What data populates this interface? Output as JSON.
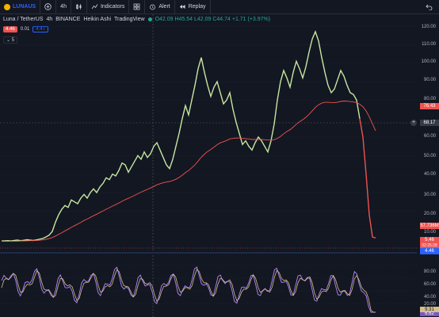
{
  "toolbar": {
    "symbol": "LUNAUS",
    "timeframe": "4h",
    "indicators_label": "Indicators",
    "alert_label": "Alert",
    "replay_label": "Replay"
  },
  "legend": {
    "title": "Luna / TetherUS",
    "interval": "4h",
    "exchange": "BINANCE",
    "chart_style": "Heikin Ashi",
    "source": "TradingView",
    "ohlc": "O42.09 H45.54 L42.09 C44.74 +1.71 (+3.97%)"
  },
  "order_boxes": {
    "sell": "4.46",
    "spread": "0.01",
    "buy": "4.47"
  },
  "collapse_label": "5",
  "price_axis": [
    "120.00",
    "110.00",
    "100.00",
    "90.00",
    "80.00",
    "60.00",
    "50.00",
    "40.00",
    "30.00",
    "20.00",
    "10.00"
  ],
  "price_tags": {
    "ma": "76.43",
    "cross": "68.17",
    "volume": "57.736M",
    "last": "5.46",
    "countdown": "02:25:28",
    "blue": "4.46"
  },
  "osc_axis": [
    "80.00",
    "60.00",
    "40.00",
    "20.00"
  ],
  "osc_tags": {
    "k": "9.31",
    "d": "6.62"
  },
  "colors": {
    "background": "#131722",
    "price": "#c8e6a0",
    "ma": "#ef5350",
    "crash": "#ef5350",
    "osc_k": "#b388ff",
    "osc_d": "#d4c08a"
  },
  "chart_data": {
    "type": "line",
    "series": [
      {
        "values": [
          3.8,
          3.9,
          4.0,
          3.8,
          4.1,
          4.3,
          4.0,
          4.2,
          4.5,
          4.3,
          4.1,
          4.4,
          4.8,
          5.2,
          6.0,
          7.0,
          9.0,
          14,
          18,
          21,
          23,
          22,
          26,
          25,
          24,
          27,
          29,
          27,
          30,
          32,
          30,
          33,
          35,
          38,
          37,
          40,
          39,
          42,
          46,
          45,
          41,
          44,
          47,
          50,
          48,
          52,
          49,
          51,
          55,
          57,
          53,
          49,
          45,
          43,
          48,
          55,
          62,
          70,
          77,
          72,
          80,
          88,
          97,
          103,
          95,
          88,
          82,
          87,
          90,
          84,
          78,
          80,
          84,
          75,
          68,
          62,
          56,
          58,
          55,
          53,
          57,
          60,
          58,
          55,
          52,
          58,
          67,
          80,
          90,
          96,
          92,
          87,
          95,
          101,
          97,
          92,
          98,
          106,
          113,
          117,
          112,
          103,
          95,
          88,
          84,
          86,
          91,
          96,
          93,
          88,
          84,
          83,
          80,
          70,
          60,
          40,
          18,
          6,
          5.46
        ]
      },
      {
        "values": [
          3.6,
          3.6,
          3.6,
          3.7,
          3.7,
          3.7,
          3.8,
          3.8,
          3.9,
          4.0,
          4.0,
          4.1,
          4.2,
          4.4,
          4.7,
          5.1,
          5.7,
          6.5,
          7.4,
          8.3,
          9.3,
          10.2,
          11.2,
          12.1,
          13.0,
          13.9,
          14.9,
          15.7,
          16.6,
          17.5,
          18.3,
          19.2,
          20.1,
          21.0,
          21.8,
          22.7,
          23.5,
          24.4,
          25.3,
          26.2,
          26.9,
          27.7,
          28.5,
          29.4,
          30.2,
          31.0,
          31.7,
          32.5,
          33.3,
          34.2,
          34.8,
          35.3,
          35.7,
          36.0,
          36.5,
          37.2,
          38.2,
          39.4,
          40.8,
          41.9,
          43.4,
          45.0,
          47.0,
          49.1,
          50.8,
          52.2,
          53.3,
          54.6,
          55.9,
          56.9,
          57.5,
          58.2,
          59.0,
          59.3,
          59.5,
          59.5,
          59.3,
          59.2,
          59.0,
          58.7,
          58.7,
          58.7,
          58.7,
          58.6,
          58.4,
          58.4,
          58.6,
          59.3,
          60.4,
          61.8,
          63.0,
          64.0,
          65.4,
          67.0,
          68.3,
          69.4,
          70.7,
          72.3,
          74.2,
          76.1,
          77.5,
          78.4,
          78.8,
          78.8,
          78.7,
          78.6,
          78.9,
          79.3,
          79.5,
          79.4,
          79.2,
          79.0,
          78.7,
          77.8,
          76.4,
          74.2,
          71.0,
          67.2,
          63.4
        ]
      }
    ],
    "y_range": [
      0,
      120
    ],
    "grid": true
  }
}
